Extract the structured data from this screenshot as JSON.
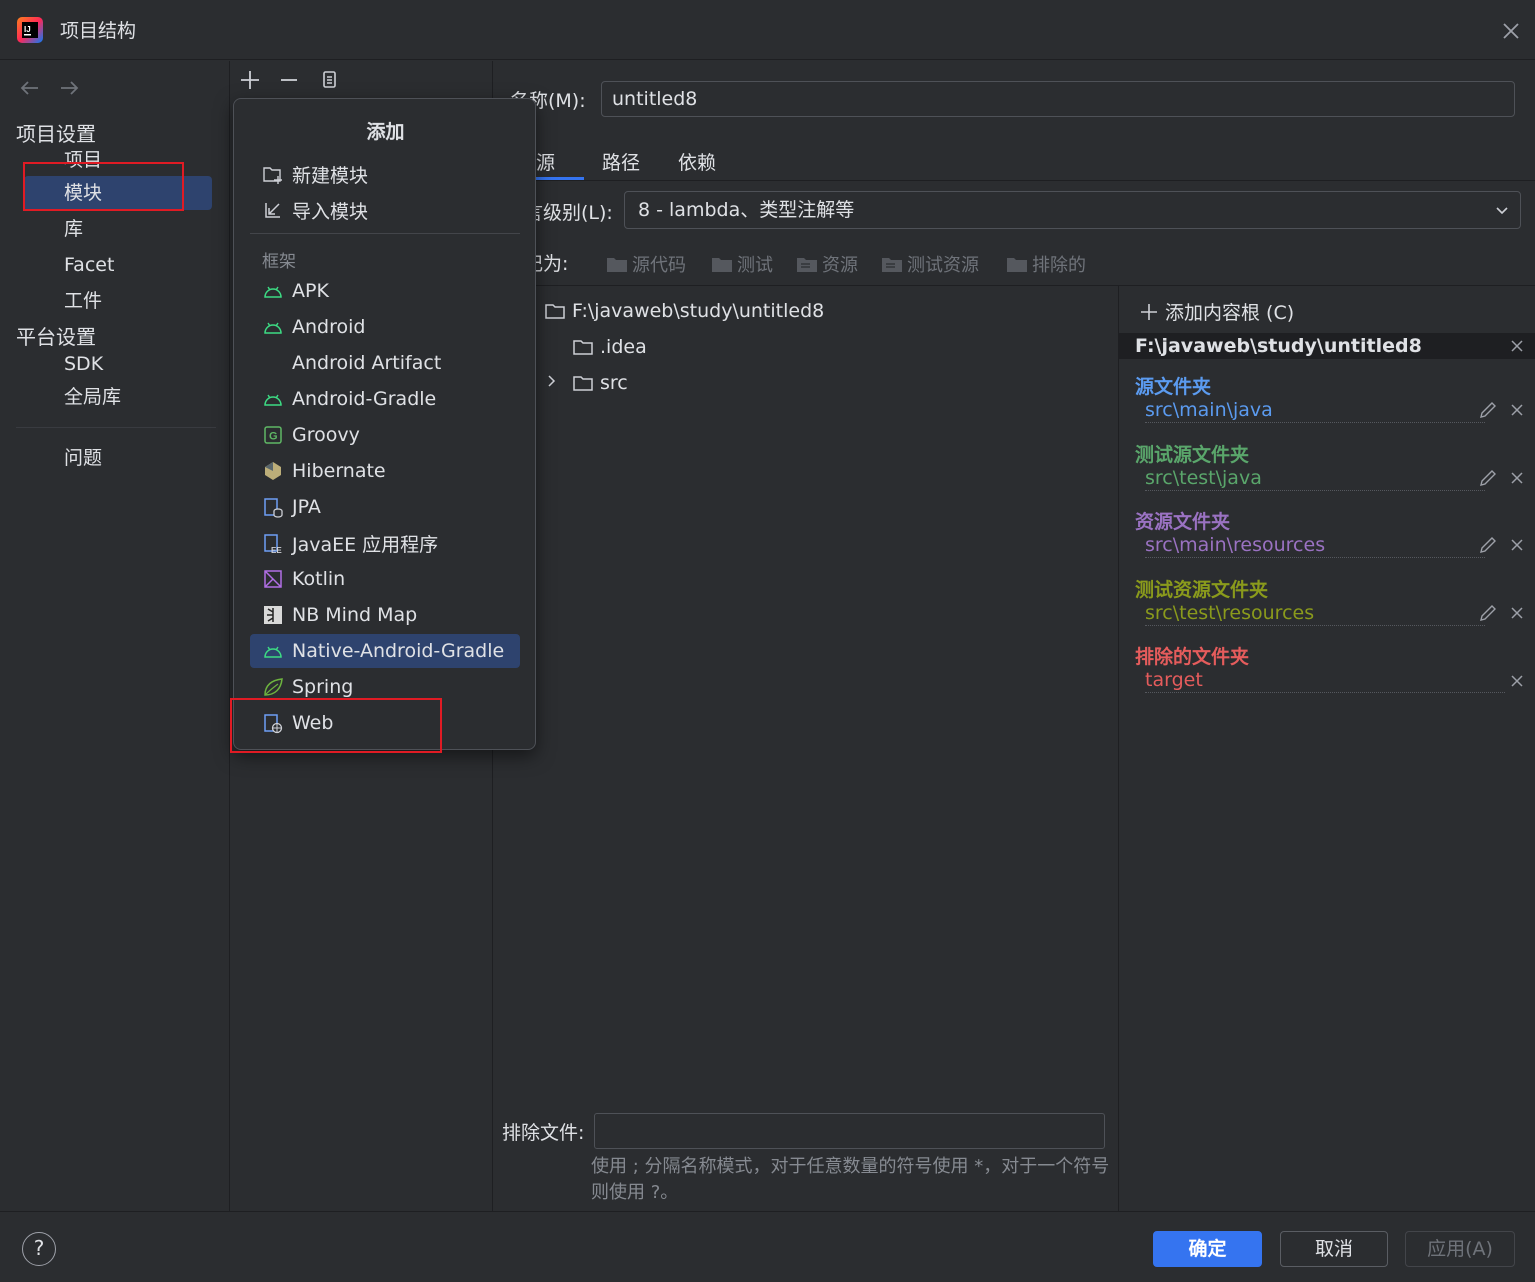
{
  "window": {
    "title": "项目结构"
  },
  "nav": {
    "section_project": "项目设置",
    "section_platform": "平台设置",
    "items_project": [
      "项目",
      "模块",
      "库",
      "Facet",
      "工件"
    ],
    "items_platform": [
      "SDK",
      "全局库"
    ],
    "problems": "问题",
    "selected": "模块"
  },
  "popup": {
    "title": "添加",
    "actions": [
      "新建模块",
      "导入模块"
    ],
    "framework_label": "框架",
    "frameworks": [
      "APK",
      "Android",
      "Android Artifact",
      "Android-Gradle",
      "Groovy",
      "Hibernate",
      "JPA",
      "JavaEE 应用程序",
      "Kotlin",
      "NB Mind Map",
      "Native-Android-Gradle",
      "Spring",
      "Web"
    ],
    "selected": "Native-Android-Gradle"
  },
  "module": {
    "name_label": "名称(M):",
    "name_value": "untitled8",
    "tabs": [
      "源",
      "路径",
      "依赖"
    ],
    "active_tab": "源",
    "language_label": "言级别(L):",
    "language_value": "8 - lambda、类型注解等",
    "markas_label": "记为:",
    "markas_buttons": [
      "源代码",
      "测试",
      "资源",
      "测试资源",
      "排除的"
    ],
    "tree": {
      "root": "F:\\javaweb\\study\\untitled8",
      "children": [
        ".idea",
        "src"
      ]
    },
    "exclude_label": "排除文件:",
    "exclude_hint": "使用 ; 分隔名称模式，对于任意数量的符号使用 *，对于一个符号则使用 ?。"
  },
  "roots": {
    "add_label": "添加内容根 (C)",
    "path": "F:\\javaweb\\study\\untitled8",
    "categories": [
      {
        "title": "源文件夹",
        "path": "src\\main\\java",
        "color": "#5b9bf0"
      },
      {
        "title": "测试源文件夹",
        "path": "src\\test\\java",
        "color": "#5aa66b"
      },
      {
        "title": "资源文件夹",
        "path": "src\\main\\resources",
        "color": "#9a72c2"
      },
      {
        "title": "测试资源文件夹",
        "path": "src\\test\\resources",
        "color": "#8a9a1c"
      },
      {
        "title": "排除的文件夹",
        "path": "target",
        "color": "#e55c5c"
      }
    ]
  },
  "footer": {
    "help": "?",
    "ok": "确定",
    "cancel": "取消",
    "apply": "应用(A)"
  },
  "colors": {
    "accent": "#3574f0",
    "selection": "#2e436e",
    "background": "#2b2d30",
    "annotation": "#e01b24"
  }
}
